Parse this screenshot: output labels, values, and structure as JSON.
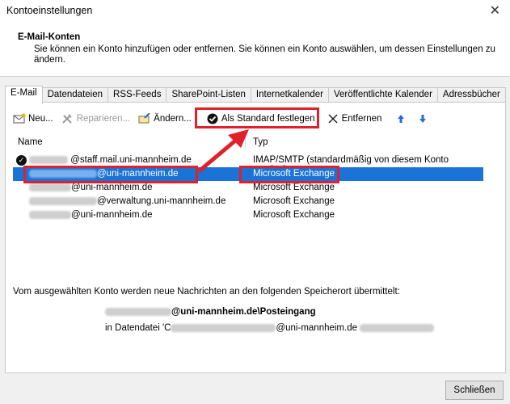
{
  "window": {
    "title": "Kontoeinstellungen",
    "close_glyph": "✕"
  },
  "header": {
    "title": "E-Mail-Konten",
    "description": "Sie können ein Konto hinzufügen oder entfernen. Sie können ein Konto auswählen, um dessen Einstellungen zu ändern."
  },
  "tabs": [
    "E-Mail",
    "Datendateien",
    "RSS-Feeds",
    "SharePoint-Listen",
    "Internetkalender",
    "Veröffentlichte Kalender",
    "Adressbücher"
  ],
  "toolbar": {
    "new": "Neu...",
    "repair": "Reparieren...",
    "change": "Ändern...",
    "set_default": "Als Standard festlegen",
    "remove": "Entfernen"
  },
  "columns": {
    "name": "Name",
    "type": "Typ"
  },
  "accounts": [
    {
      "domain": "@staff.mail.uni-mannheim.de",
      "type": "IMAP/SMTP (standardmäßig von diesem Konto senden)",
      "default": true
    },
    {
      "domain": "@uni-mannheim.de",
      "type": "Microsoft Exchange",
      "selected": true
    },
    {
      "domain": "@uni-mannheim.de",
      "type": "Microsoft Exchange"
    },
    {
      "domain": "@verwaltung.uni-mannheim.de",
      "type": "Microsoft Exchange"
    },
    {
      "domain": "@uni-mannheim.de",
      "type": "Microsoft Exchange"
    }
  ],
  "delivery": {
    "info": "Vom ausgewählten Konto werden neue Nachrichten an den folgenden Speicherort übermittelt:",
    "folder": "@uni-mannheim.de\\Posteingang",
    "datafile_prefix": "in Datendatei 'C",
    "datafile_mid": "@uni-mannheim.de"
  },
  "buttons": {
    "close": "Schließen"
  },
  "colors": {
    "highlight": "#e0202a",
    "selection": "#1a73d6"
  }
}
